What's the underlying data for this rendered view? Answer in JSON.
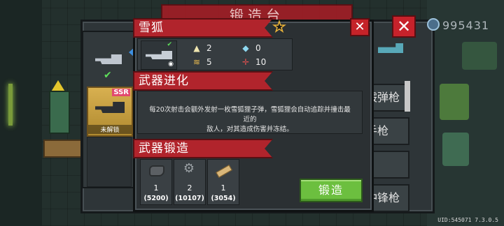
{
  "background": {
    "title": "锻造台",
    "list_items": [
      "霰弹枪",
      "手枪",
      "",
      "冲锋枪"
    ],
    "currency_value": "995431",
    "close_label": "✕"
  },
  "weapon_column": {
    "slot_2_badge": "SSR",
    "slot_2_status": "未解锁"
  },
  "dialog": {
    "weapon_name": "雪狐",
    "close_label": "✕",
    "star_label": "★",
    "stats": {
      "damage": "2",
      "energy": "0",
      "speed": "5",
      "crit": "10"
    },
    "evolution_title": "武器进化",
    "evolution_desc_line1": "每20次射击会额外发射一枚雪狐狸子弹，雪狐狸会自动追踪并撞击最近的",
    "evolution_desc_line2": "敌人，对其造成伤害并冻结。",
    "forge_title": "武器锻造",
    "materials": [
      {
        "icon": "ore-icon",
        "qty": "1",
        "cost": "(5200)"
      },
      {
        "icon": "gear-icon",
        "qty": "2",
        "cost": "(10107)"
      },
      {
        "icon": "plank-icon",
        "qty": "1",
        "cost": "(3054)"
      }
    ],
    "forge_button": "锻造"
  },
  "version_text": "UID:545071 7.3.0.5"
}
